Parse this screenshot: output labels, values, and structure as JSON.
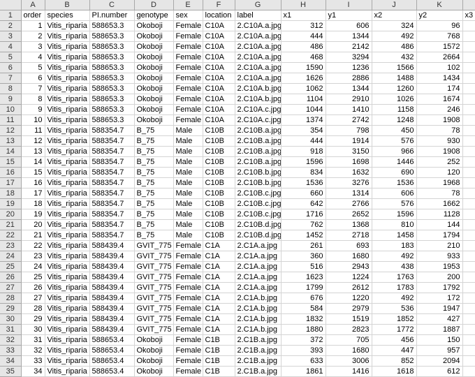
{
  "col_letters": [
    "A",
    "B",
    "C",
    "D",
    "E",
    "F",
    "G",
    "H",
    "I",
    "J",
    "K"
  ],
  "rows": [
    {
      "r": "1",
      "cells": [
        "order",
        "species",
        "PI.number",
        "genotype",
        "sex",
        "location",
        "label",
        "x1",
        "y1",
        "x2",
        "y2",
        "x3"
      ],
      "header": true
    },
    {
      "r": "2",
      "cells": [
        "1",
        "Vitis_riparia",
        "588653.3",
        "Okoboji",
        "Female",
        "C10A",
        "2.C10A.a.jpg",
        "312",
        "606",
        "324",
        "96",
        ""
      ]
    },
    {
      "r": "3",
      "cells": [
        "2",
        "Vitis_riparia",
        "588653.3",
        "Okoboji",
        "Female",
        "C10A",
        "2.C10A.a.jpg",
        "444",
        "1344",
        "492",
        "768",
        ""
      ]
    },
    {
      "r": "4",
      "cells": [
        "3",
        "Vitis_riparia",
        "588653.3",
        "Okoboji",
        "Female",
        "C10A",
        "2.C10A.a.jpg",
        "486",
        "2142",
        "486",
        "1572",
        ""
      ]
    },
    {
      "r": "5",
      "cells": [
        "4",
        "Vitis_riparia",
        "588653.3",
        "Okoboji",
        "Female",
        "C10A",
        "2.C10A.a.jpg",
        "468",
        "3294",
        "432",
        "2664",
        ""
      ]
    },
    {
      "r": "6",
      "cells": [
        "5",
        "Vitis_riparia",
        "588653.3",
        "Okoboji",
        "Female",
        "C10A",
        "2.C10A.a.jpg",
        "1590",
        "1236",
        "1566",
        "102",
        ""
      ]
    },
    {
      "r": "7",
      "cells": [
        "6",
        "Vitis_riparia",
        "588653.3",
        "Okoboji",
        "Female",
        "C10A",
        "2.C10A.a.jpg",
        "1626",
        "2886",
        "1488",
        "1434",
        ""
      ]
    },
    {
      "r": "8",
      "cells": [
        "7",
        "Vitis_riparia",
        "588653.3",
        "Okoboji",
        "Female",
        "C10A",
        "2.C10A.b.jpg",
        "1062",
        "1344",
        "1260",
        "174",
        ""
      ]
    },
    {
      "r": "9",
      "cells": [
        "8",
        "Vitis_riparia",
        "588653.3",
        "Okoboji",
        "Female",
        "C10A",
        "2.C10A.b.jpg",
        "1104",
        "2910",
        "1026",
        "1674",
        ""
      ]
    },
    {
      "r": "10",
      "cells": [
        "9",
        "Vitis_riparia",
        "588653.3",
        "Okoboji",
        "Female",
        "C10A",
        "2.C10A.c.jpg",
        "1044",
        "1410",
        "1158",
        "246",
        ""
      ]
    },
    {
      "r": "11",
      "cells": [
        "10",
        "Vitis_riparia",
        "588653.3",
        "Okoboji",
        "Female",
        "C10A",
        "2.C10A.c.jpg",
        "1374",
        "2742",
        "1248",
        "1908",
        ""
      ]
    },
    {
      "r": "12",
      "cells": [
        "11",
        "Vitis_riparia",
        "588354.7",
        "B_75",
        "Male",
        "C10B",
        "2.C10B.a.jpg",
        "354",
        "798",
        "450",
        "78",
        ""
      ]
    },
    {
      "r": "13",
      "cells": [
        "12",
        "Vitis_riparia",
        "588354.7",
        "B_75",
        "Male",
        "C10B",
        "2.C10B.a.jpg",
        "444",
        "1914",
        "576",
        "930",
        ""
      ]
    },
    {
      "r": "14",
      "cells": [
        "13",
        "Vitis_riparia",
        "588354.7",
        "B_75",
        "Male",
        "C10B",
        "2.C10B.a.jpg",
        "918",
        "3150",
        "966",
        "1908",
        ""
      ]
    },
    {
      "r": "15",
      "cells": [
        "14",
        "Vitis_riparia",
        "588354.7",
        "B_75",
        "Male",
        "C10B",
        "2.C10B.a.jpg",
        "1596",
        "1698",
        "1446",
        "252",
        ""
      ]
    },
    {
      "r": "16",
      "cells": [
        "15",
        "Vitis_riparia",
        "588354.7",
        "B_75",
        "Male",
        "C10B",
        "2.C10B.b.jpg",
        "834",
        "1632",
        "690",
        "120",
        ""
      ]
    },
    {
      "r": "17",
      "cells": [
        "16",
        "Vitis_riparia",
        "588354.7",
        "B_75",
        "Male",
        "C10B",
        "2.C10B.b.jpg",
        "1536",
        "3276",
        "1536",
        "1968",
        ""
      ]
    },
    {
      "r": "18",
      "cells": [
        "17",
        "Vitis_riparia",
        "588354.7",
        "B_75",
        "Male",
        "C10B",
        "2.C10B.c.jpg",
        "660",
        "1314",
        "606",
        "78",
        ""
      ]
    },
    {
      "r": "19",
      "cells": [
        "18",
        "Vitis_riparia",
        "588354.7",
        "B_75",
        "Male",
        "C10B",
        "2.C10B.c.jpg",
        "642",
        "2766",
        "576",
        "1662",
        ""
      ]
    },
    {
      "r": "20",
      "cells": [
        "19",
        "Vitis_riparia",
        "588354.7",
        "B_75",
        "Male",
        "C10B",
        "2.C10B.c.jpg",
        "1716",
        "2652",
        "1596",
        "1128",
        ""
      ]
    },
    {
      "r": "21",
      "cells": [
        "20",
        "Vitis_riparia",
        "588354.7",
        "B_75",
        "Male",
        "C10B",
        "2.C10B.d.jpg",
        "762",
        "1368",
        "810",
        "144",
        ""
      ]
    },
    {
      "r": "22",
      "cells": [
        "21",
        "Vitis_riparia",
        "588354.7",
        "B_75",
        "Male",
        "C10B",
        "2.C10B.d.jpg",
        "1452",
        "2718",
        "1458",
        "1794",
        ""
      ]
    },
    {
      "r": "23",
      "cells": [
        "22",
        "Vitis_riparia",
        "588439.4",
        "GVIT_775",
        "Female",
        "C1A",
        "2.C1A.a.jpg",
        "261",
        "693",
        "183",
        "210",
        ""
      ]
    },
    {
      "r": "24",
      "cells": [
        "23",
        "Vitis_riparia",
        "588439.4",
        "GVIT_775",
        "Female",
        "C1A",
        "2.C1A.a.jpg",
        "360",
        "1680",
        "492",
        "933",
        ""
      ]
    },
    {
      "r": "25",
      "cells": [
        "24",
        "Vitis_riparia",
        "588439.4",
        "GVIT_775",
        "Female",
        "C1A",
        "2.C1A.a.jpg",
        "516",
        "2943",
        "438",
        "1953",
        ""
      ]
    },
    {
      "r": "26",
      "cells": [
        "25",
        "Vitis_riparia",
        "588439.4",
        "GVIT_775",
        "Female",
        "C1A",
        "2.C1A.a.jpg",
        "1623",
        "1224",
        "1763",
        "200",
        ""
      ]
    },
    {
      "r": "27",
      "cells": [
        "26",
        "Vitis_riparia",
        "588439.4",
        "GVIT_775",
        "Female",
        "C1A",
        "2.C1A.a.jpg",
        "1799",
        "2612",
        "1783",
        "1792",
        ""
      ]
    },
    {
      "r": "28",
      "cells": [
        "27",
        "Vitis_riparia",
        "588439.4",
        "GVIT_775",
        "Female",
        "C1A",
        "2.C1A.b.jpg",
        "676",
        "1220",
        "492",
        "172",
        ""
      ]
    },
    {
      "r": "29",
      "cells": [
        "28",
        "Vitis_riparia",
        "588439.4",
        "GVIT_775",
        "Female",
        "C1A",
        "2.C1A.b.jpg",
        "584",
        "2979",
        "536",
        "1947",
        ""
      ]
    },
    {
      "r": "30",
      "cells": [
        "29",
        "Vitis_riparia",
        "588439.4",
        "GVIT_775",
        "Female",
        "C1A",
        "2.C1A.b.jpg",
        "1832",
        "1519",
        "1852",
        "427",
        ""
      ]
    },
    {
      "r": "31",
      "cells": [
        "30",
        "Vitis_riparia",
        "588439.4",
        "GVIT_775",
        "Female",
        "C1A",
        "2.C1A.b.jpg",
        "1880",
        "2823",
        "1772",
        "1887",
        ""
      ]
    },
    {
      "r": "32",
      "cells": [
        "31",
        "Vitis_riparia",
        "588653.4",
        "Okoboji",
        "Female",
        "C1B",
        "2.C1B.a.jpg",
        "372",
        "705",
        "456",
        "150",
        ""
      ]
    },
    {
      "r": "33",
      "cells": [
        "32",
        "Vitis_riparia",
        "588653.4",
        "Okoboji",
        "Female",
        "C1B",
        "2.C1B.a.jpg",
        "393",
        "1680",
        "447",
        "957",
        ""
      ]
    },
    {
      "r": "34",
      "cells": [
        "33",
        "Vitis_riparia",
        "588653.4",
        "Okoboji",
        "Female",
        "C1B",
        "2.C1B.a.jpg",
        "633",
        "3006",
        "852",
        "2094",
        ""
      ]
    },
    {
      "r": "35",
      "cells": [
        "34",
        "Vitis_riparia",
        "588653.4",
        "Okoboji",
        "Female",
        "C1B",
        "2.C1B.a.jpg",
        "1861",
        "1416",
        "1618",
        "612",
        ""
      ]
    }
  ]
}
